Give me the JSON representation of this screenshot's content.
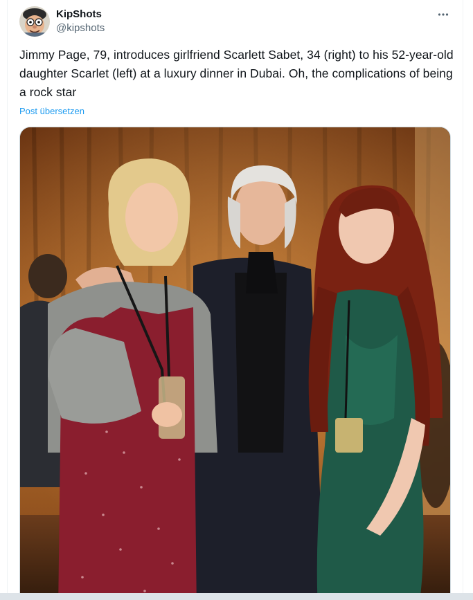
{
  "post": {
    "author": {
      "display_name": "KipShots",
      "handle": "@kipshots",
      "avatar_icon": "cartoon-face-avatar"
    },
    "more_icon": "more-horizontal-icon",
    "text": "Jimmy Page, 79, introduces girlfriend Scarlett Sabet, 34 (right) to his 52-year-old daughter Scarlet (left) at a luxury dinner in Dubai. Oh, the complications of being a rock star",
    "translate_label": "Post übersetzen",
    "media": {
      "kind": "photo",
      "subject": "three-people-posing-at-dinner-event"
    }
  },
  "colors": {
    "text_primary": "#0f1419",
    "text_secondary": "#536471",
    "link": "#1d9bf0",
    "border": "#cfd9de"
  }
}
